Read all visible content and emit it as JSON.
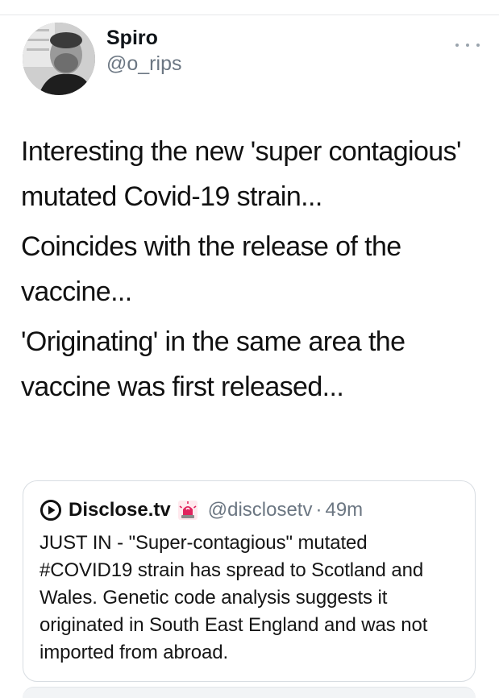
{
  "tweet": {
    "author": {
      "display_name": "Spiro",
      "handle": "@o_rips"
    },
    "paragraphs": [
      "Interesting the new 'super contagious' mutated Covid-19 strain...",
      "Coincides with the release of the vaccine...",
      "'Originating' in the same area the vaccine was first released..."
    ]
  },
  "quoted_tweet": {
    "display_name": "Disclose.tv",
    "handle": "@disclosetv",
    "separator": "·",
    "time": "49m",
    "text": "JUST IN - \"Super-contagious\" mutated #COVID19 strain has spread to Scotland and Wales. Genetic code analysis suggests it originated in South East England and was not imported from abroad."
  },
  "icons": {
    "more": "more-options-icon",
    "quoted_logo": "play-circle-icon",
    "emoji": "police-siren-icon"
  },
  "colors": {
    "text": "#0f1419",
    "secondary": "#6b7682",
    "border": "#d8dde2",
    "siren": "#e0245e"
  }
}
